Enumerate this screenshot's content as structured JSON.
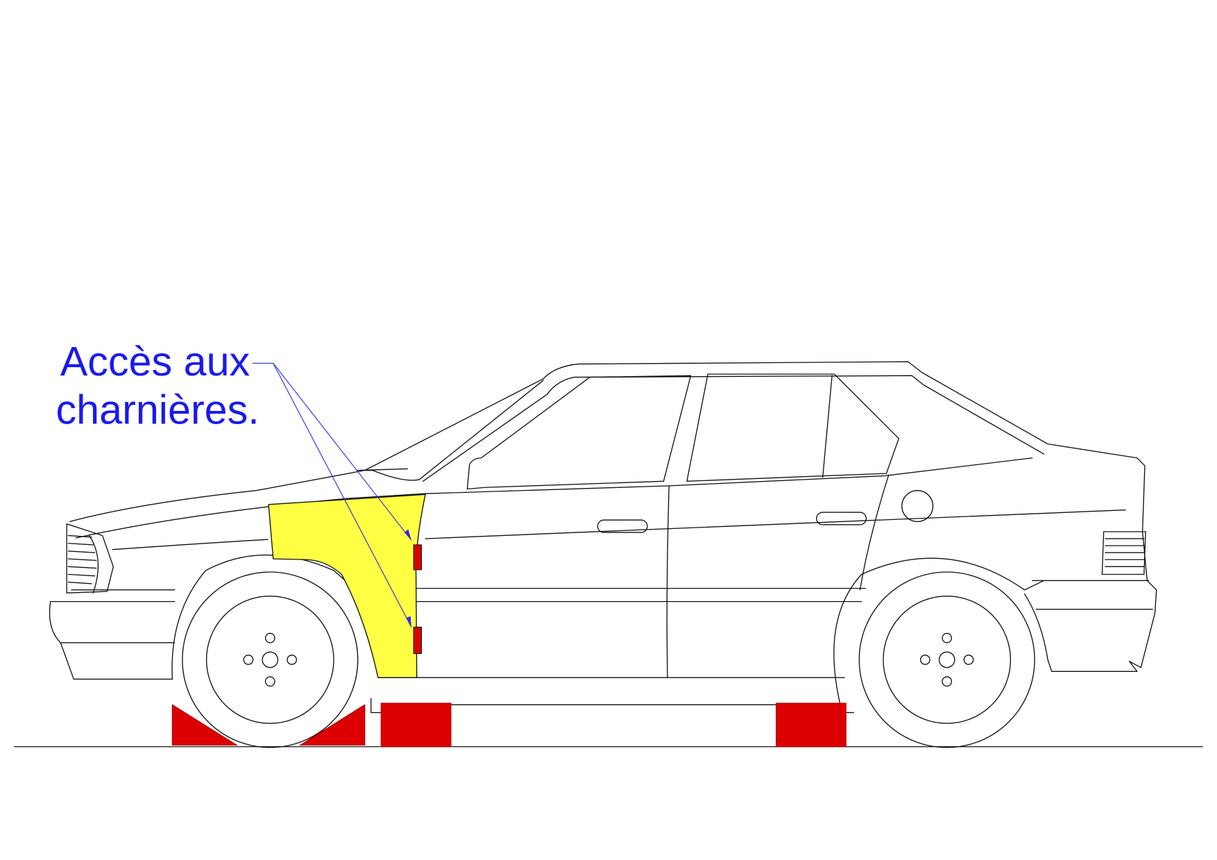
{
  "annotation": {
    "line1": "Accès aux",
    "line2": "charnières."
  },
  "colors": {
    "outline": "#111111",
    "fender_highlight": "#ffff44",
    "support_blocks": "#dd0000",
    "hinges": "#dd0000",
    "annotation_text": "#1a1aee",
    "leader_lines": "#2a2aee"
  },
  "labels": {
    "fender": "front-fender",
    "hinges": "door-hinges",
    "blocks": "support-blocks"
  }
}
